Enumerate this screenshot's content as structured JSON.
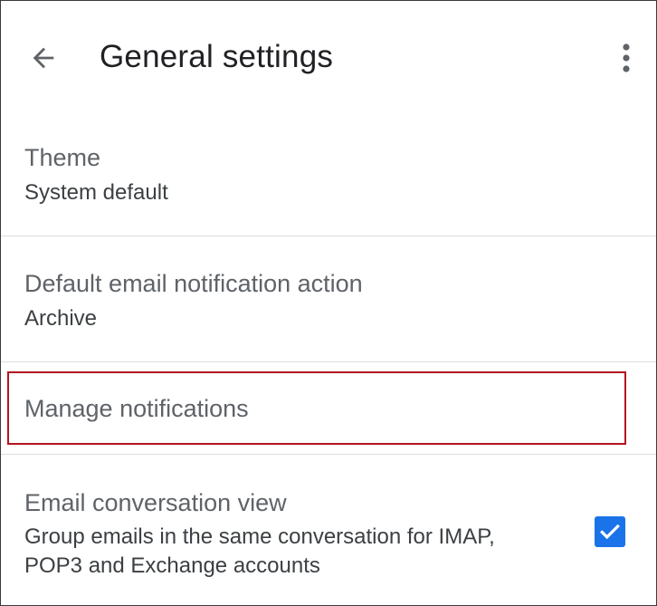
{
  "header": {
    "title": "General settings",
    "back_icon": "arrow-left-icon",
    "more_icon": "more-vert-icon"
  },
  "settings": {
    "theme": {
      "label": "Theme",
      "value": "System default"
    },
    "notification_action": {
      "label": "Default email notification action",
      "value": "Archive"
    },
    "manage_notifications": {
      "label": "Manage notifications"
    },
    "conversation_view": {
      "label": "Email conversation view",
      "description_line1": "Group emails in the same conversation for IMAP,",
      "description_line2": "POP3 and Exchange accounts",
      "checked": true
    }
  },
  "colors": {
    "accent": "#1a73e8",
    "highlight_border": "#b3141f",
    "divider": "#dadce0",
    "title_text": "#202124",
    "primary_text": "#5f6368",
    "secondary_text": "#3c4043"
  }
}
